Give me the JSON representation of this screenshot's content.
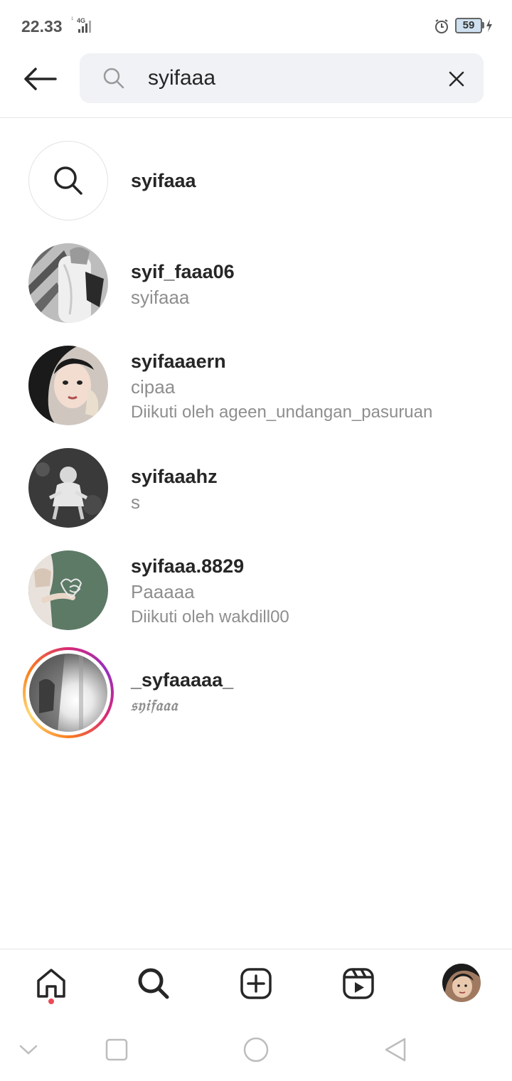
{
  "status_bar": {
    "time": "22.33",
    "network": "4G",
    "battery": "59"
  },
  "search": {
    "query": "syifaaa"
  },
  "results": [
    {
      "type": "keyword",
      "name": "syifaaa"
    },
    {
      "type": "account",
      "name": "syif_faaa06",
      "subtitle": "syifaaa"
    },
    {
      "type": "account",
      "name": "syifaaaern",
      "subtitle": "cipaa",
      "followed_by": "Diikuti oleh ageen_undangan_pasuruan"
    },
    {
      "type": "account",
      "name": "syifaaahz",
      "subtitle": "s"
    },
    {
      "type": "account",
      "name": "syifaaa.8829",
      "subtitle": "Paaaaa",
      "followed_by": "Diikuti oleh wakdill00"
    },
    {
      "type": "account",
      "name": "_syfaaaaa_",
      "subtitle": "𝔰𝔶𝔦𝔣𝔞𝔞𝔞",
      "has_story": true
    }
  ],
  "bottom_nav": {
    "items": [
      "home-icon",
      "search-icon",
      "create-icon",
      "reels-icon",
      "profile-avatar"
    ],
    "active": "search-icon",
    "notification_color": "#ed4956"
  },
  "colors": {
    "primary_text": "#262626",
    "secondary_text": "#8e8e8e",
    "search_bg": "#f0f2f5"
  }
}
